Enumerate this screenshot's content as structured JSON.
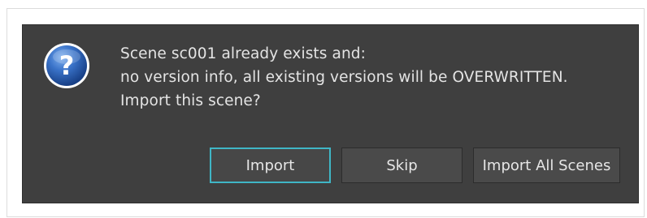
{
  "dialog": {
    "icon": "question-icon",
    "message_lines": [
      "Scene sc001 already exists and:",
      "no version info, all existing versions will be OVERWRITTEN.",
      "Import this scene?"
    ],
    "buttons": {
      "import": "Import",
      "skip": "Skip",
      "import_all": "Import All Scenes"
    }
  },
  "colors": {
    "dialog_background": "#3f3f3f",
    "button_background": "#4a4a4a",
    "focus_outline": "#3fb6c6",
    "icon_blue": "#2a5fb0",
    "text": "#e4e4e4"
  }
}
